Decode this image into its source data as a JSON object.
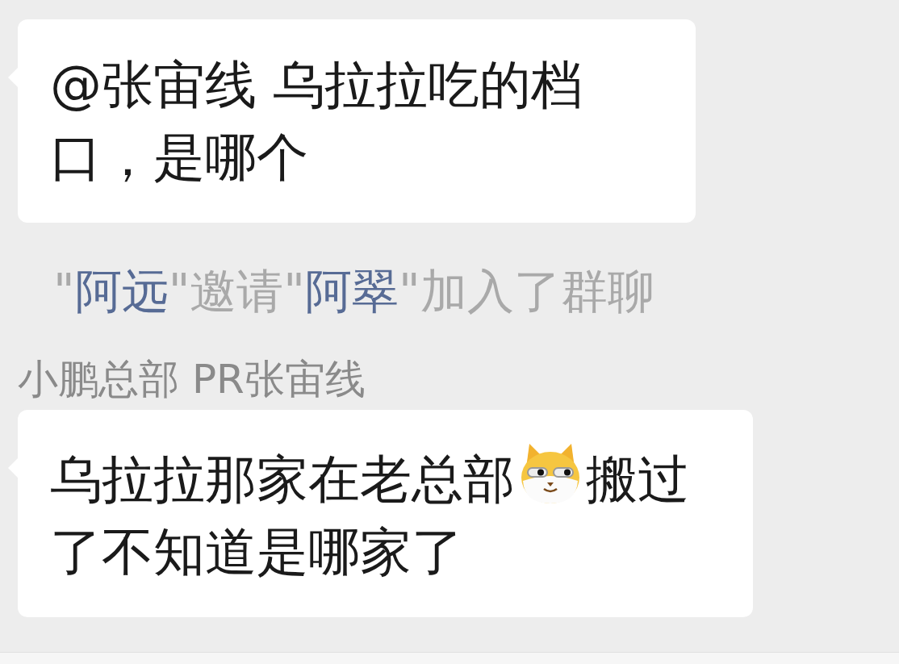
{
  "messages": [
    {
      "kind": "bubble",
      "parts": [
        {
          "kind": "text",
          "text": "@张宙线 乌拉拉吃的档口，是哪个"
        }
      ]
    },
    {
      "kind": "system",
      "parts": [
        {
          "kind": "plain",
          "text": "\""
        },
        {
          "kind": "name",
          "text": "阿远"
        },
        {
          "kind": "plain",
          "text": "\"邀请\""
        },
        {
          "kind": "name",
          "text": "阿翠"
        },
        {
          "kind": "plain",
          "text": "\"加入了群聊"
        }
      ]
    },
    {
      "kind": "bubble",
      "sender": "小鹏总部 PR张宙线",
      "parts": [
        {
          "kind": "text",
          "text": "乌拉拉那家在老总部"
        },
        {
          "kind": "sticker"
        },
        {
          "kind": "text",
          "text": "搬过了不知道是哪家了"
        }
      ]
    }
  ]
}
